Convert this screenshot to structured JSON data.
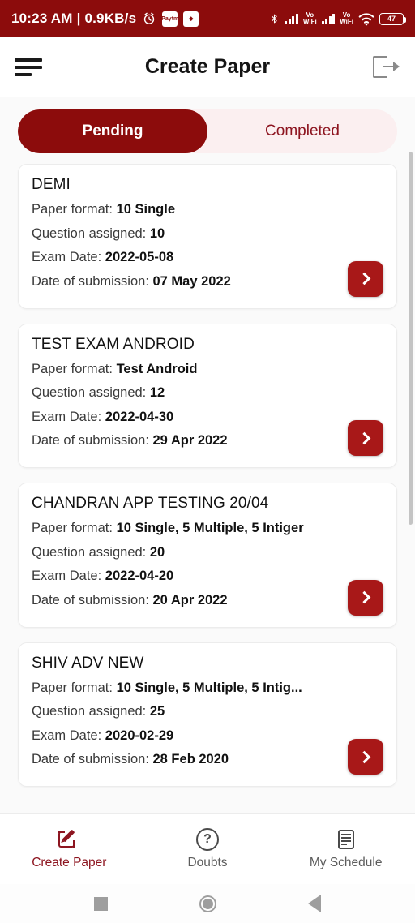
{
  "status_bar": {
    "time": "10:23 AM",
    "separator": "|",
    "network_speed": "0.9KB/s",
    "alarm_icon": "alarm-clock-icon",
    "app_badges": [
      {
        "name": "paytm-icon",
        "label": "Paytm"
      },
      {
        "name": "app-icon",
        "label": "◆"
      }
    ],
    "bluetooth_icon": "bluetooth-icon",
    "sim1_label": "Vo\nWiFi",
    "sim1_line1": "Vo",
    "sim1_line2": "WiFi",
    "sim2_line1": "Vo",
    "sim2_line2": "WiFi",
    "wifi_icon": "wifi-icon",
    "battery_level": "47",
    "background_color": "#8c0c0c"
  },
  "app_bar": {
    "menu_icon": "hamburger-menu-icon",
    "title": "Create Paper",
    "logout_icon": "logout-icon"
  },
  "tabs": {
    "items": [
      {
        "label": "Pending",
        "active": true
      },
      {
        "label": "Completed",
        "active": false
      }
    ],
    "active_color": "#8c0c0c",
    "inactive_bg": "#fbeff0",
    "inactive_text": "#8d1520"
  },
  "labels": {
    "paper_format": "Paper format:",
    "question_assigned": "Question assigned:",
    "exam_date": "Exam Date:",
    "date_of_submission": "Date of submission:"
  },
  "papers": [
    {
      "title": "DEMI",
      "paper_format": "10 Single",
      "question_assigned": "10",
      "exam_date": "2022-05-08",
      "date_of_submission": "07 May 2022",
      "action_icon": "chevron-right-icon"
    },
    {
      "title": "TEST EXAM ANDROID",
      "paper_format": "Test Android",
      "question_assigned": "12",
      "exam_date": "2022-04-30",
      "date_of_submission": "29 Apr 2022",
      "action_icon": "chevron-right-icon"
    },
    {
      "title": "CHANDRAN APP TESTING 20/04",
      "paper_format": "10 Single, 5 Multiple, 5 Intiger",
      "question_assigned": "20",
      "exam_date": "2022-04-20",
      "date_of_submission": "20 Apr 2022",
      "action_icon": "chevron-right-icon"
    },
    {
      "title": "SHIV ADV NEW",
      "paper_format": "10 Single, 5 Multiple, 5 Intig...",
      "question_assigned": "25",
      "exam_date": "2020-02-29",
      "date_of_submission": "28 Feb 2020",
      "action_icon": "chevron-right-icon"
    }
  ],
  "bottom_nav": {
    "items": [
      {
        "label": "Create Paper",
        "icon": "create-paper-icon",
        "active": true
      },
      {
        "label": "Doubts",
        "icon": "question-mark-circle-icon",
        "active": false,
        "glyph": "?"
      },
      {
        "label": "My Schedule",
        "icon": "document-icon",
        "active": false
      }
    ]
  },
  "android_nav": {
    "recents_icon": "recents-square-icon",
    "home_icon": "home-circle-icon",
    "back_icon": "back-triangle-icon"
  }
}
